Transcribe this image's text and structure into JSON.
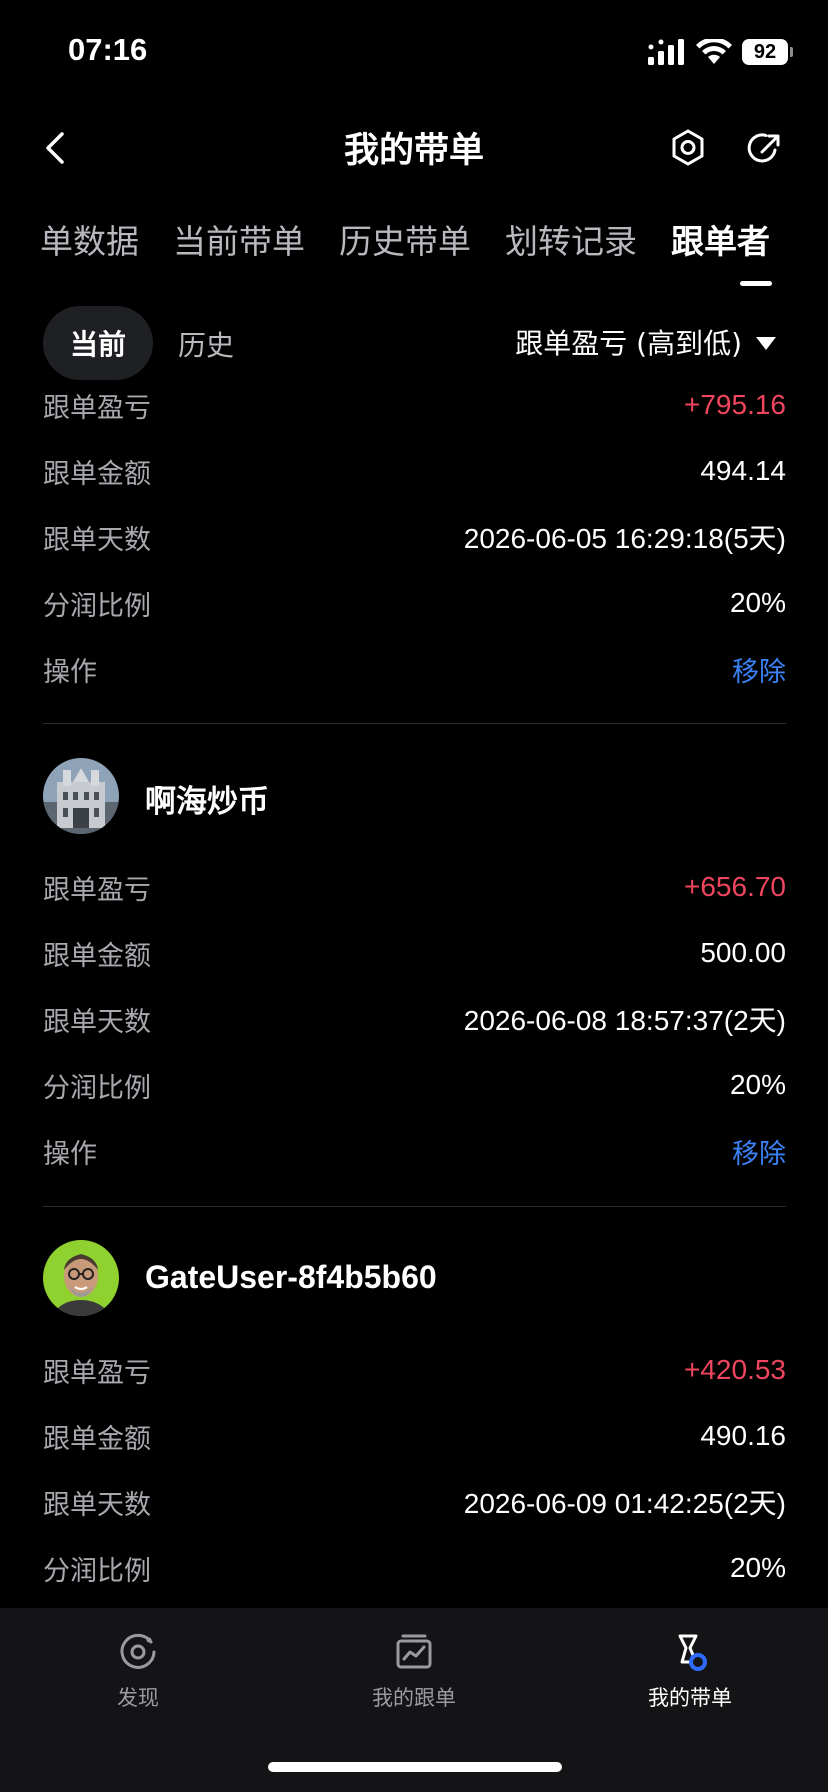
{
  "status_bar": {
    "time": "07:16",
    "battery": "92"
  },
  "header": {
    "title": "我的带单"
  },
  "tabs": [
    {
      "label": "单数据"
    },
    {
      "label": "当前带单"
    },
    {
      "label": "历史带单"
    },
    {
      "label": "划转记录"
    },
    {
      "label": "跟单者"
    }
  ],
  "filter": {
    "current_label": "当前",
    "history_label": "历史",
    "sort_label": "跟单盈亏 (高到低)"
  },
  "labels": {
    "pnl": "跟单盈亏",
    "amount": "跟单金额",
    "days": "跟单天数",
    "share": "分润比例",
    "action": "操作"
  },
  "followers": [
    {
      "pnl": "+795.16",
      "amount": "494.14",
      "days": "2026-06-05 16:29:18(5天)",
      "share": "20%",
      "action": "移除"
    },
    {
      "name": "啊海炒币",
      "pnl": "+656.70",
      "amount": "500.00",
      "days": "2026-06-08 18:57:37(2天)",
      "share": "20%",
      "action": "移除"
    },
    {
      "name": "GateUser-8f4b5b60",
      "pnl": "+420.53",
      "amount": "490.16",
      "days": "2026-06-09 01:42:25(2天)",
      "share": "20%"
    }
  ],
  "bottom_nav": [
    {
      "label": "发现",
      "icon": "discover-icon"
    },
    {
      "label": "我的跟单",
      "icon": "chart-box-icon"
    },
    {
      "label": "我的带单",
      "icon": "lead-trade-icon"
    }
  ],
  "colors": {
    "positive": "#f0455e",
    "link": "#3b82f6",
    "background": "#000000"
  }
}
